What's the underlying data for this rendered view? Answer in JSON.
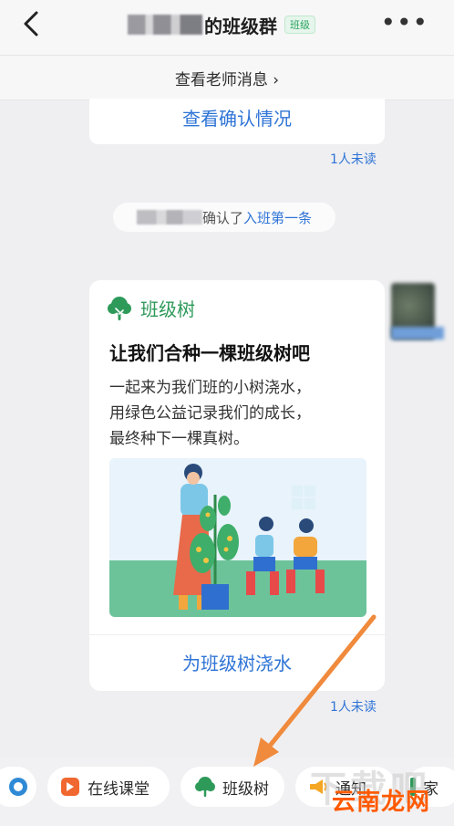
{
  "header": {
    "title_suffix": "的班级群",
    "badge": "班级",
    "more": "•••"
  },
  "teacher_bar": {
    "label": "查看老师消息 ›"
  },
  "top_card": {
    "link": "查看确认情况",
    "unread": "1人未读"
  },
  "system_message": {
    "text": "确认了",
    "link": "入班第一条"
  },
  "class_tree_card": {
    "app_name": "班级树",
    "title": "让我们合种一棵班级树吧",
    "desc_line1": "一起来为我们班的小树浇水，",
    "desc_line2": "用绿色公益记录我们的成长，",
    "desc_line3": "最终种下一棵真树。",
    "action": "为班级树浇水",
    "unread": "1人未读"
  },
  "bottom_bar": {
    "chip_online_class": "在线课堂",
    "chip_class_tree": "班级树",
    "chip_notice": "通知",
    "chip_home": "家"
  },
  "watermark": {
    "text": "云南龙网",
    "ghost": "下载吧"
  },
  "colors": {
    "link_blue": "#2f74d6",
    "brand_green": "#2e9a5a",
    "arrow_orange": "#f08a3c",
    "watermark_orange": "#ff5a00"
  }
}
